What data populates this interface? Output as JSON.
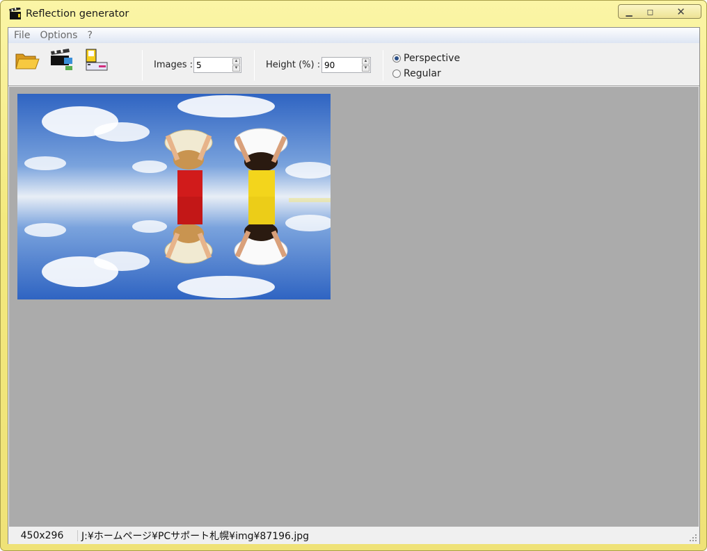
{
  "window": {
    "title": "Reflection generator",
    "title_icon": "clapperboard-icon",
    "controls": [
      "minimize-icon",
      "maximize-icon",
      "close-icon"
    ]
  },
  "menu": {
    "items": [
      "File",
      "Options",
      "?"
    ]
  },
  "toolbar": {
    "tools": [
      "open-folder-icon",
      "reflect-icon",
      "save-icon"
    ],
    "images_label": "Images :",
    "images_value": "5",
    "height_label": "Height (%) :",
    "height_value": "90",
    "mode_options": [
      {
        "label": "Perspective",
        "selected": true
      },
      {
        "label": "Regular",
        "selected": false
      }
    ]
  },
  "preview": {
    "description_icon": "reflection-preview-image",
    "sky_color": "#3f72c8"
  },
  "status": {
    "dimensions": "450x296",
    "path": "J:¥ホームページ¥PCサポート札幌¥img¥87196.jpg"
  }
}
